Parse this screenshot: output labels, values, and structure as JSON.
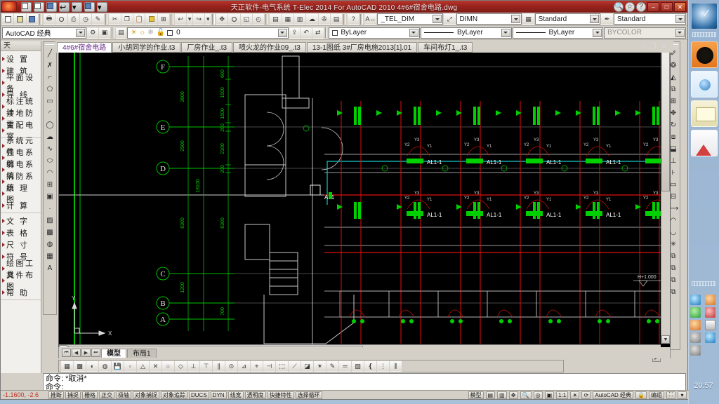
{
  "window": {
    "title": "天正软件-电气系统 T-Elec 2014  For AutoCAD 2010    4#6#宿舍电路.dwg",
    "minimize_label": "–",
    "maximize_label": "□",
    "close_label": "✕",
    "help_label": "?"
  },
  "quick_access": {
    "items": [
      {
        "name": "new-file",
        "glyph": "▢"
      },
      {
        "name": "open-file",
        "glyph": "📂"
      },
      {
        "name": "save-file",
        "glyph": "💾"
      },
      {
        "name": "undo",
        "glyph": "↩"
      },
      {
        "name": "undo-dropdown",
        "glyph": "▾"
      },
      {
        "name": "plot",
        "glyph": "🖶"
      },
      {
        "name": "plot-dropdown",
        "glyph": "▾"
      }
    ]
  },
  "standard_toolbar": {
    "buttons": [
      {
        "name": "new",
        "glyph": "▢"
      },
      {
        "name": "open",
        "glyph": "📂"
      },
      {
        "name": "save",
        "glyph": "💾"
      },
      {
        "name": "plot",
        "glyph": "🖶"
      },
      {
        "name": "plot-preview",
        "glyph": "🔍"
      },
      {
        "name": "publish",
        "glyph": "⎙"
      },
      {
        "name": "3d-print",
        "glyph": "◷"
      },
      {
        "name": "markup",
        "glyph": "✎"
      },
      {
        "name": "cut",
        "glyph": "✂"
      },
      {
        "name": "copy",
        "glyph": "❐"
      },
      {
        "name": "paste",
        "glyph": "📋"
      },
      {
        "name": "match-properties",
        "glyph": "🖌"
      },
      {
        "name": "block-editor",
        "glyph": "⊞"
      },
      {
        "name": "undo",
        "glyph": "↩"
      },
      {
        "name": "redo",
        "glyph": "↪"
      },
      {
        "name": "pan",
        "glyph": "✥"
      },
      {
        "name": "zoom-realtime",
        "glyph": "🔍"
      },
      {
        "name": "zoom-window",
        "glyph": "◱"
      },
      {
        "name": "zoom-previous",
        "glyph": "◴"
      },
      {
        "name": "properties",
        "glyph": "▤"
      },
      {
        "name": "design-center",
        "glyph": "▦"
      },
      {
        "name": "tool-palettes",
        "glyph": "▥"
      },
      {
        "name": "sheet-set",
        "glyph": "☁"
      },
      {
        "name": "markup-set",
        "glyph": "✇"
      },
      {
        "name": "layer-manager",
        "glyph": "▤"
      },
      {
        "name": "help",
        "glyph": "?"
      }
    ]
  },
  "workspace": {
    "selector_value": "AutoCAD 经典",
    "settings_icon": "gear-icon",
    "snapshot_icon": "snapshot-icon"
  },
  "layer_toolbar": {
    "layer_props_icon": "layer-properties-icon",
    "current_layer": "0",
    "state_icons": [
      "lightbulb-icon",
      "sun-icon",
      "freeze-icon",
      "lock-icon",
      "color-swatch-icon"
    ],
    "make_current_icon": "make-current-icon",
    "previous_icon": "layer-previous-icon",
    "match_icon": "layer-match-icon"
  },
  "properties_toolbar": {
    "color_value": "ByLayer",
    "linetype_value": "ByLayer",
    "lineweight_value": "ByLayer",
    "plotstyle_value": "BYCOLOR"
  },
  "annotation_toolbar": {
    "dimstyle_icon": "dimension-style-icon",
    "dimstyle_value": "_TEL_DIM",
    "multileader_icon": "multileader-icon",
    "multileader_value": "DIMN",
    "tablestyle_icon": "table-style-icon",
    "tablestyle_value": "Standard",
    "textstyle_icon": "text-style-icon",
    "textstyle_value": "Standard"
  },
  "palette": {
    "header": "天",
    "groups": [
      {
        "items": [
          {
            "label": "设  置",
            "name": "settings"
          },
          {
            "label": "建  筑",
            "name": "architecture"
          },
          {
            "label": "平面设备",
            "name": "plan-equipment"
          },
          {
            "label": "导  线",
            "name": "wires"
          },
          {
            "label": "标注统计",
            "name": "dimension-stats"
          },
          {
            "label": "接地防雷",
            "name": "grounding-lightning"
          },
          {
            "label": "变配电室",
            "name": "substation-room"
          }
        ]
      },
      {
        "items": [
          {
            "label": "系统元件",
            "name": "system-components"
          },
          {
            "label": "强电系统",
            "name": "power-system"
          },
          {
            "label": "弱电系统",
            "name": "weak-current-system"
          },
          {
            "label": "消防系统",
            "name": "fire-system"
          },
          {
            "label": "原 理 图",
            "name": "schematic"
          },
          {
            "label": "计  算",
            "name": "calculation"
          }
        ]
      },
      {
        "items": [
          {
            "label": "文  字",
            "name": "text"
          },
          {
            "label": "表  格",
            "name": "table"
          },
          {
            "label": "尺  寸",
            "name": "dimension"
          },
          {
            "label": "符  号",
            "name": "symbol"
          },
          {
            "label": "绘图工具",
            "name": "drawing-tools"
          },
          {
            "label": "文件布图",
            "name": "file-layout"
          },
          {
            "label": "帮  助",
            "name": "help"
          }
        ]
      }
    ]
  },
  "draw_toolbar": {
    "buttons": [
      {
        "name": "line",
        "glyph": "╱"
      },
      {
        "name": "construction-line",
        "glyph": "✗"
      },
      {
        "name": "polyline",
        "glyph": "⌐"
      },
      {
        "name": "polygon",
        "glyph": "⬠"
      },
      {
        "name": "rectangle",
        "glyph": "▭"
      },
      {
        "name": "arc",
        "glyph": "◜"
      },
      {
        "name": "circle",
        "glyph": "◯"
      },
      {
        "name": "revision-cloud",
        "glyph": "☁"
      },
      {
        "name": "spline",
        "glyph": "∿"
      },
      {
        "name": "ellipse",
        "glyph": "⬭"
      },
      {
        "name": "ellipse-arc",
        "glyph": "◠"
      },
      {
        "name": "insert-block",
        "glyph": "⊞"
      },
      {
        "name": "make-block",
        "glyph": "▣"
      },
      {
        "name": "point",
        "glyph": "·"
      },
      {
        "name": "hatch",
        "glyph": "▨"
      },
      {
        "name": "gradient",
        "glyph": "▩"
      },
      {
        "name": "region",
        "glyph": "◍"
      },
      {
        "name": "table",
        "glyph": "▦"
      },
      {
        "name": "multiline-text",
        "glyph": "A"
      }
    ]
  },
  "modify_toolbar": {
    "buttons": [
      {
        "name": "erase",
        "glyph": "✐"
      },
      {
        "name": "copy-object",
        "glyph": "❂"
      },
      {
        "name": "mirror",
        "glyph": "◭"
      },
      {
        "name": "offset",
        "glyph": "⧉"
      },
      {
        "name": "array",
        "glyph": "⊞"
      },
      {
        "name": "move",
        "glyph": "✥"
      },
      {
        "name": "rotate",
        "glyph": "↻"
      },
      {
        "name": "scale",
        "glyph": "⧈"
      },
      {
        "name": "stretch",
        "glyph": "⬓"
      },
      {
        "name": "trim",
        "glyph": "⊥"
      },
      {
        "name": "extend",
        "glyph": "⊦"
      },
      {
        "name": "break-at-point",
        "glyph": "▭"
      },
      {
        "name": "break",
        "glyph": "⊟"
      },
      {
        "name": "join",
        "glyph": "⟷"
      },
      {
        "name": "chamfer",
        "glyph": "◠"
      },
      {
        "name": "fillet",
        "glyph": "◡"
      },
      {
        "name": "explode",
        "glyph": "✳"
      },
      {
        "name": "draw-order-front",
        "glyph": "⧉"
      },
      {
        "name": "draw-order-back",
        "glyph": "⧉"
      },
      {
        "name": "draw-order-above",
        "glyph": "⧉"
      },
      {
        "name": "draw-order-below",
        "glyph": "⧉"
      }
    ]
  },
  "document_tabs": [
    {
      "label": "4#6#宿舍电路",
      "active": true
    },
    {
      "label": "小胡同学的作业.t3",
      "active": false
    },
    {
      "label": "厂房作业_.t3",
      "active": false
    },
    {
      "label": "喷火龙的作业09_.t3",
      "active": false
    },
    {
      "label": "13-1图纸 3#厂房电施2013[1].01",
      "active": false
    },
    {
      "label": "车间布灯1_.t3",
      "active": false
    }
  ],
  "model_tabs": {
    "nav": [
      "⏮",
      "◀",
      "▶",
      "⏭"
    ],
    "tabs": [
      {
        "label": "模型",
        "active": true
      },
      {
        "label": "布局1",
        "active": false
      }
    ]
  },
  "drawing": {
    "axis_labels": [
      "F",
      "E",
      "D",
      "C",
      "B",
      "A"
    ],
    "dimensions_outer": [
      "19100"
    ],
    "dimensions_col1": [
      "3600",
      "2500",
      "6300",
      "1200"
    ],
    "dimensions_col2": [
      "600",
      "1500",
      "1500",
      "200",
      "200",
      "2100",
      "6300",
      "700"
    ],
    "panel_labels": [
      "AL1",
      "AL1-1",
      "AL1-1",
      "AL1-1",
      "AL1-1",
      "AL1-1",
      "AL1-1"
    ],
    "switch_labels": [
      "Y1",
      "Y2",
      "Y3"
    ],
    "elevation_note": "H+1.000",
    "ucs_x": "X",
    "ucs_y": "Y"
  },
  "bottom_toolbar": {
    "buttons": [
      {
        "name": "quick-calc",
        "glyph": "▦"
      },
      {
        "name": "chart",
        "glyph": "▩"
      },
      {
        "name": "render",
        "glyph": "◐"
      },
      {
        "name": "visual-style",
        "glyph": "◍"
      },
      {
        "name": "save-view",
        "glyph": "💾"
      },
      {
        "name": "osnap-endpoint",
        "glyph": "▫"
      },
      {
        "name": "osnap-midpoint",
        "glyph": "△"
      },
      {
        "name": "osnap-intersection",
        "glyph": "✕"
      },
      {
        "name": "osnap-center",
        "glyph": "○"
      },
      {
        "name": "osnap-quadrant",
        "glyph": "◇"
      },
      {
        "name": "osnap-tangent",
        "glyph": "⊥"
      },
      {
        "name": "osnap-perpendicular",
        "glyph": "⊤"
      },
      {
        "name": "osnap-parallel",
        "glyph": "∥"
      },
      {
        "name": "osnap-node",
        "glyph": "⊙"
      },
      {
        "name": "osnap-insert",
        "glyph": "⊿"
      },
      {
        "name": "osnap-nearest",
        "glyph": "⌖"
      },
      {
        "name": "osnap-extension",
        "glyph": "⊣"
      },
      {
        "name": "osnap-none",
        "glyph": "⬚"
      },
      {
        "name": "osnap-apparent",
        "glyph": "⟋"
      },
      {
        "name": "osnap-settings",
        "glyph": "◪"
      },
      {
        "name": "temp-track",
        "glyph": "✴"
      },
      {
        "name": "from-point",
        "glyph": "✎"
      },
      {
        "name": "equal-spacing",
        "glyph": "═"
      },
      {
        "name": "layer-iso",
        "glyph": "▨"
      },
      {
        "name": "brace",
        "glyph": "❴"
      },
      {
        "name": "align-left",
        "glyph": "⋮"
      },
      {
        "name": "align-other",
        "glyph": "⫼"
      }
    ]
  },
  "command_line": {
    "history": "命令: *取消*",
    "prompt": "命令:"
  },
  "status_bar": {
    "coordinates": "-1.1600,  -2.6",
    "toggles": [
      "推断",
      "捕捉",
      "栅格",
      "正交",
      "极轴",
      "对象捕捉",
      "对象追踪",
      "DUCS",
      "DYN",
      "线宽",
      "透明度",
      "快捷特性",
      "选择循环"
    ],
    "model_label": "模型",
    "layout_icons": [
      "layout-icon",
      "annotation-icon"
    ],
    "view_icons": [
      "pan-icon",
      "zoom-icon",
      "steering-wheel-icon",
      "showmotion-icon"
    ],
    "annotation_scale": "1:1",
    "annotation_visibility_icon": "annotation-visibility-icon",
    "auto_scale_icon": "auto-scale-icon",
    "workspace_label": "AutoCAD 经典",
    "lock_icon": "lock-icon",
    "group_label": "编组",
    "clean_screen_icon": "clean-screen-icon",
    "tray_expand_icon": "tray-expand-icon"
  },
  "tray": {
    "clock": "20:57",
    "icons": [
      "network-icon",
      "antivirus-shield-icon",
      "messenger-icon",
      "update-icon",
      "download-manager-icon",
      "calendar-icon",
      "input-method-icon",
      "performance-icon",
      "volume-icon"
    ]
  },
  "sidebar_gadgets": [
    {
      "name": "clock-gadget"
    },
    {
      "name": "cpu-meter-gadget"
    },
    {
      "name": "feed-headlines-gadget"
    },
    {
      "name": "notes-gadget"
    },
    {
      "name": "picture-puzzle-gadget"
    }
  ],
  "colors": {
    "title_red": "#98231d",
    "chrome": "#d4d0c8",
    "canvas": "#000000",
    "dim_green": "#00d000",
    "wire_red": "#e01010",
    "conduit_cyan": "#18c8c8",
    "accent_purple": "#6a2f8a"
  }
}
